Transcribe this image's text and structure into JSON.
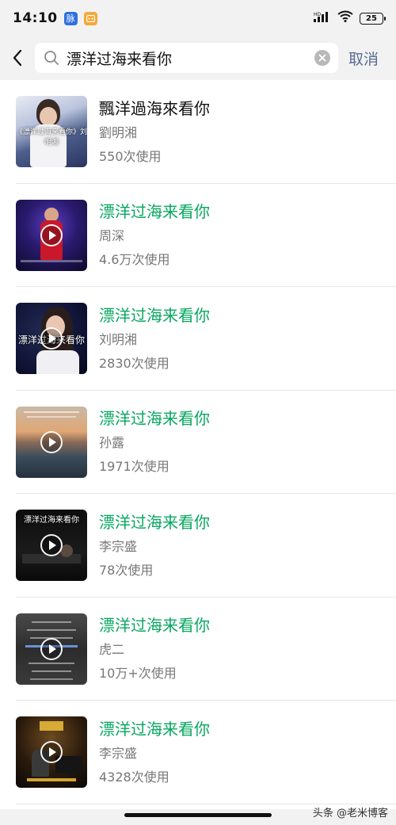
{
  "status_bar": {
    "time": "14:10",
    "app_badge_1": "脉",
    "battery": "25",
    "icons": [
      "signal-icon",
      "wifi-icon",
      "battery-icon"
    ]
  },
  "search": {
    "query": "漂洋过海来看你",
    "cancel_label": "取消"
  },
  "results": [
    {
      "title": "飄洋過海來看你",
      "artist": "劉明湘",
      "usage": "550次使用",
      "highlight": false,
      "thumb_text": "《漂洋过海来看你》刘明湘"
    },
    {
      "title": "漂洋过海来看你",
      "artist": "周深",
      "usage": "4.6万次使用",
      "highlight": true,
      "thumb_text": ""
    },
    {
      "title": "漂洋过海来看你",
      "artist": "刘明湘",
      "usage": "2830次使用",
      "highlight": true,
      "thumb_text": "漂洋过海来看你"
    },
    {
      "title": "漂洋过海来看你",
      "artist": "孙露",
      "usage": "1971次使用",
      "highlight": true,
      "thumb_text": ""
    },
    {
      "title": "漂洋过海来看你",
      "artist": "李宗盛",
      "usage": "78次使用",
      "highlight": true,
      "thumb_text": "漂洋过海来看你"
    },
    {
      "title": "漂洋过海来看你",
      "artist": "虎二",
      "usage": "10万+次使用",
      "highlight": true,
      "thumb_text": ""
    },
    {
      "title": "漂洋过海来看你",
      "artist": "李宗盛",
      "usage": "4328次使用",
      "highlight": true,
      "thumb_text": ""
    }
  ],
  "colors": {
    "highlight_title": "#07a760",
    "cancel": "#576b95",
    "secondary_text": "#777777"
  },
  "watermark": "头条 @老米博客"
}
